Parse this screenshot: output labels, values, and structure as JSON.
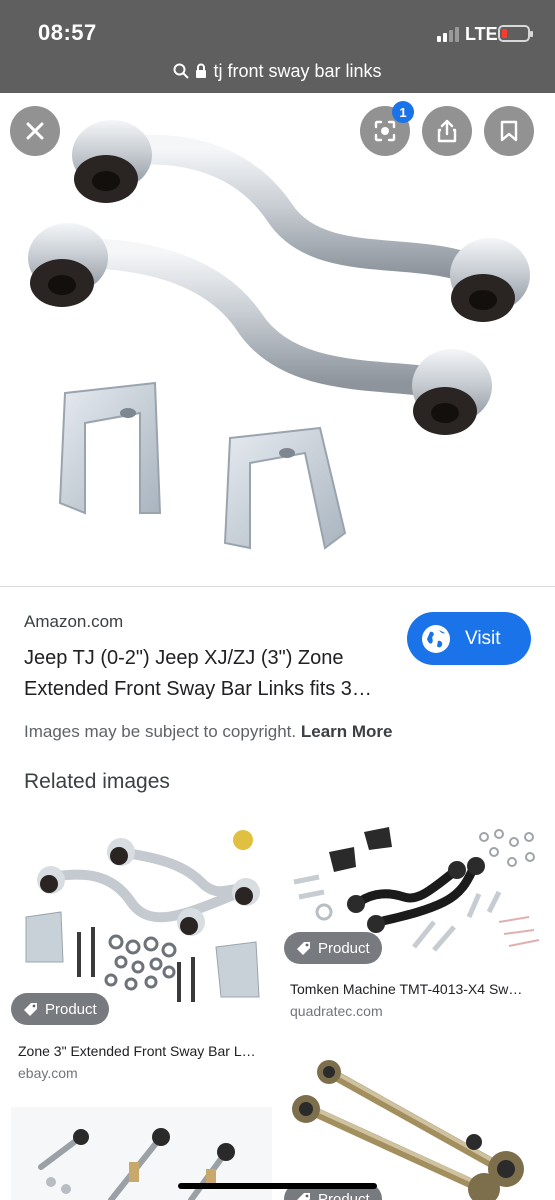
{
  "status_bar": {
    "time": "08:57",
    "network": "LTE"
  },
  "url_bar": {
    "query": "tj front sway bar links"
  },
  "viewer": {
    "badge_count": "1"
  },
  "result": {
    "source": "Amazon.com",
    "title_line1": "Jeep TJ (0-2\") Jeep XJ/ZJ (3\") Zone",
    "title_line2": "Extended Front Sway Bar Links fits 3…",
    "visit_label": "Visit",
    "copyright_text": "Images may be subject to copyright.",
    "learn_more": "Learn More"
  },
  "related": {
    "heading": "Related images",
    "items": [
      {
        "chip": "Product",
        "title": "Zone 3\" Extended Front Sway Bar L…",
        "source": "ebay.com"
      },
      {
        "chip": "Product",
        "title": "Tomken Machine TMT-4013-X4 Sw…",
        "source": "quadratec.com"
      },
      {
        "chip": "Product",
        "title": "",
        "source": ""
      }
    ]
  },
  "colors": {
    "accent": "#1a73e8",
    "top_bar": "#5f5f5f"
  }
}
